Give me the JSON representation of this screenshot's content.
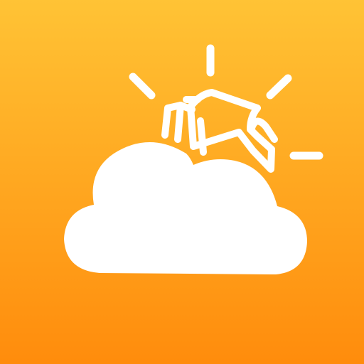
{
  "icon": {
    "semantic": "weather-app-icon",
    "motif": [
      "cloud-icon",
      "sun-rays-icon",
      "waving-hand-icon"
    ]
  },
  "colors": {
    "gradient_top": "#FFC335",
    "gradient_bottom": "#FF8C0C",
    "glyph": "#FFFFFF"
  }
}
